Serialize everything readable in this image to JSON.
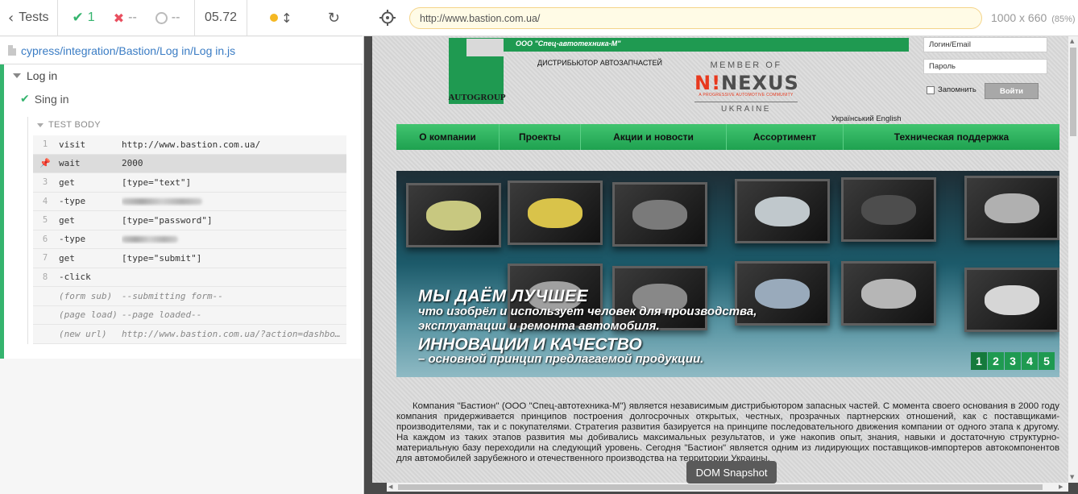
{
  "runner": {
    "back_label": "Tests",
    "stats": {
      "passed": "1",
      "failed": "--",
      "pending": "--"
    },
    "duration": "05.72",
    "spec_path": "cypress/integration/Bastion/Log in/Log in.js",
    "suite_title": "Log in",
    "test_title": "Sing in",
    "test_body_label": "TEST BODY",
    "commands": [
      {
        "num": "1",
        "name": "visit",
        "message": "http://www.bastion.com.ua/"
      },
      {
        "num": "",
        "name": "wait",
        "message": "2000",
        "pinned": true
      },
      {
        "num": "3",
        "name": "get",
        "message": "[type=\"text\"]"
      },
      {
        "num": "4",
        "name": "-type",
        "message": ""
      },
      {
        "num": "5",
        "name": "get",
        "message": "[type=\"password\"]"
      },
      {
        "num": "6",
        "name": "-type",
        "message": ""
      },
      {
        "num": "7",
        "name": "get",
        "message": "[type=\"submit\"]"
      },
      {
        "num": "8",
        "name": "-click",
        "message": ""
      },
      {
        "num": "",
        "name": "(form sub)",
        "message": "--submitting form--"
      },
      {
        "num": "",
        "name": "(page load)",
        "message": "--page loaded--"
      },
      {
        "num": "",
        "name": "(new url)",
        "message": "http://www.bastion.com.ua/?action=dashboard"
      }
    ]
  },
  "aut": {
    "url": "http://www.bastion.com.ua/",
    "viewport": "1000 x 660",
    "zoom": "(85%)",
    "snapshot_label": "DOM Snapshot"
  },
  "site": {
    "logo_text": "AUTOGROUP",
    "company": "ООО \"Спец-автотехника-М\"",
    "distributor": "ДИСТРИБЬЮТОР АВТОЗАПЧАСТЕЙ",
    "nexus": {
      "member_of": "MEMBER OF",
      "name": "N!NEXUS",
      "tagline": "A PROGRESSIVE AUTOMOTIVE COMMUNITY",
      "country": "UKRAINE"
    },
    "login_placeholder": "Логин/Email",
    "password_placeholder": "Пароль",
    "remember_label": "Запомнить",
    "login_button": "Войти",
    "languages": "Український English",
    "nav": [
      "О компании",
      "Проекты",
      "Акции и новости",
      "Ассортимент",
      "Техническая поддержка"
    ],
    "banner": {
      "title1": "МЫ ДАЁМ ЛУЧШЕЕ",
      "sub1": "что изобрёл и использует человек для производства, эксплуатации и ремонта автомобиля.",
      "title2": "ИННОВАЦИИ И КАЧЕСТВО",
      "sub2": "– основной принцип предлагаемой продукции.",
      "pages": [
        "1",
        "2",
        "3",
        "4",
        "5"
      ]
    },
    "about": "Компания \"Бастион\" (ООО \"Спец-автотехника-М\") является независимым дистрибьютором запасных частей. С момента своего основания в 2000 году компания придерживается принципов построения долгосрочных открытых, честных, прозрачных партнерских отношений, как с поставщиками-производителями, так и с покупателями. Стратегия развития базируется на принципе последовательного движения компании от одного этапа к другому. На каждом из таких этапов развития мы добивались максимальных результатов, и уже накопив опыт, знания, навыки и достаточную структурно-материальную базу переходили на следующий уровень. Сегодня \"Бастион\" является одним из лидирующих поставщиков-импортеров автокомпонентов для автомобилей зарубежного и отечественного производства на территории Украины."
  },
  "colors": {
    "pass": "#35b46e",
    "fail": "#e94f5f",
    "brand_green": "#1f9a51"
  }
}
